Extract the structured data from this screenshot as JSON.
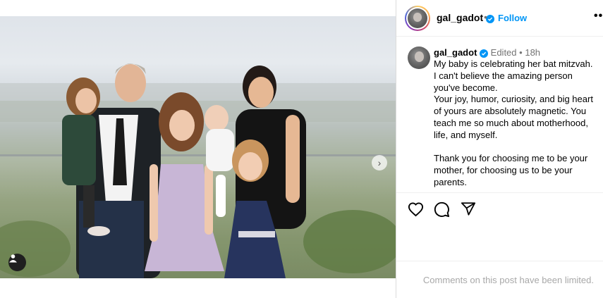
{
  "post": {
    "username": "gal_gadot",
    "header_separator": "•",
    "follow_label": "Follow",
    "more_label": "•••",
    "caption": {
      "username": "gal_gadot",
      "edited": "Edited",
      "separator": "•",
      "time": "18h",
      "text": "My baby is celebrating her bat mitzvah. I can't believe the amazing person you've become.\nYour joy, humor, curiosity, and big heart of yours are absolutely magnetic. You teach me so much about motherhood, life, and myself.\n\nThank you for choosing me to be your mother, for choosing us to be your parents."
    },
    "comments_notice": "Comments on this post have been limited."
  },
  "icons": {
    "verified": "verified-badge-icon",
    "like": "heart-icon",
    "comment": "comment-icon",
    "share": "share-icon",
    "next": "chevron-right-icon",
    "tags": "user-tag-icon",
    "more": "more-options-icon"
  },
  "colors": {
    "accent": "#0095f6",
    "muted": "#737373",
    "notice": "#a8a8a8"
  }
}
